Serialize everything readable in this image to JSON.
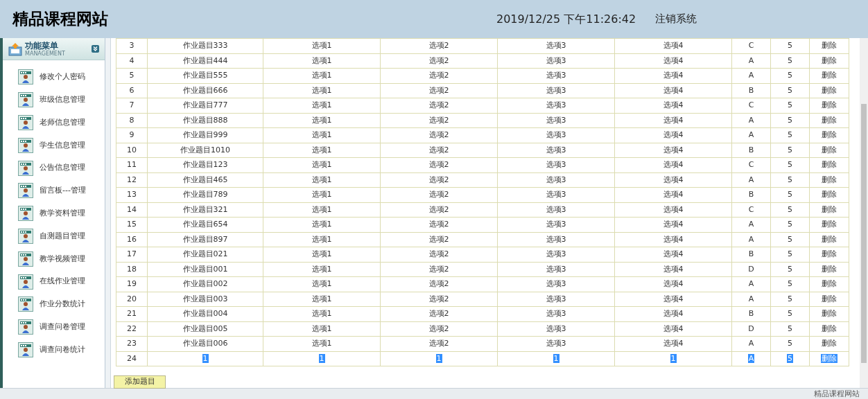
{
  "header": {
    "title": "精品课程网站",
    "datetime": "2019/12/25 下午11:26:42",
    "logout": "注销系统"
  },
  "sidebar": {
    "title": "功能菜单",
    "subtitle": "MANAGEMENT",
    "items": [
      {
        "label": "修改个人密码"
      },
      {
        "label": "班级信息管理"
      },
      {
        "label": "老师信息管理"
      },
      {
        "label": "学生信息管理"
      },
      {
        "label": "公告信息管理"
      },
      {
        "label": "留言板---管理"
      },
      {
        "label": "教学资料管理"
      },
      {
        "label": "自测题目管理"
      },
      {
        "label": "教学视频管理"
      },
      {
        "label": "在线作业管理"
      },
      {
        "label": "作业分数统计"
      },
      {
        "label": "调查问卷管理"
      },
      {
        "label": "调查问卷统计"
      }
    ]
  },
  "table": {
    "rows": [
      {
        "no": "3",
        "title": "作业题目333",
        "options": [
          "选项1",
          "选项2",
          "选项3",
          "选项4"
        ],
        "answer": "C",
        "score": "5",
        "action": "删除",
        "text_selected": false
      },
      {
        "no": "4",
        "title": "作业题目444",
        "options": [
          "选项1",
          "选项2",
          "选项3",
          "选项4"
        ],
        "answer": "A",
        "score": "5",
        "action": "删除",
        "text_selected": false
      },
      {
        "no": "5",
        "title": "作业题目555",
        "options": [
          "选项1",
          "选项2",
          "选项3",
          "选项4"
        ],
        "answer": "A",
        "score": "5",
        "action": "删除",
        "text_selected": false
      },
      {
        "no": "6",
        "title": "作业题目666",
        "options": [
          "选项1",
          "选项2",
          "选项3",
          "选项4"
        ],
        "answer": "B",
        "score": "5",
        "action": "删除",
        "text_selected": false
      },
      {
        "no": "7",
        "title": "作业题目777",
        "options": [
          "选项1",
          "选项2",
          "选项3",
          "选项4"
        ],
        "answer": "C",
        "score": "5",
        "action": "删除",
        "text_selected": false
      },
      {
        "no": "8",
        "title": "作业题目888",
        "options": [
          "选项1",
          "选项2",
          "选项3",
          "选项4"
        ],
        "answer": "A",
        "score": "5",
        "action": "删除",
        "text_selected": false
      },
      {
        "no": "9",
        "title": "作业题目999",
        "options": [
          "选项1",
          "选项2",
          "选项3",
          "选项4"
        ],
        "answer": "A",
        "score": "5",
        "action": "删除",
        "text_selected": false
      },
      {
        "no": "10",
        "title": "作业题目1010",
        "options": [
          "选项1",
          "选项2",
          "选项3",
          "选项4"
        ],
        "answer": "B",
        "score": "5",
        "action": "删除",
        "text_selected": false
      },
      {
        "no": "11",
        "title": "作业题目123",
        "options": [
          "选项1",
          "选项2",
          "选项3",
          "选项4"
        ],
        "answer": "C",
        "score": "5",
        "action": "删除",
        "text_selected": false
      },
      {
        "no": "12",
        "title": "作业题目465",
        "options": [
          "选项1",
          "选项2",
          "选项3",
          "选项4"
        ],
        "answer": "A",
        "score": "5",
        "action": "删除",
        "text_selected": false
      },
      {
        "no": "13",
        "title": "作业题目789",
        "options": [
          "选项1",
          "选项2",
          "选项3",
          "选项4"
        ],
        "answer": "B",
        "score": "5",
        "action": "删除",
        "text_selected": false
      },
      {
        "no": "14",
        "title": "作业题目321",
        "options": [
          "选项1",
          "选项2",
          "选项3",
          "选项4"
        ],
        "answer": "C",
        "score": "5",
        "action": "删除",
        "text_selected": false
      },
      {
        "no": "15",
        "title": "作业题目654",
        "options": [
          "选项1",
          "选项2",
          "选项3",
          "选项4"
        ],
        "answer": "A",
        "score": "5",
        "action": "删除",
        "text_selected": false
      },
      {
        "no": "16",
        "title": "作业题目897",
        "options": [
          "选项1",
          "选项2",
          "选项3",
          "选项4"
        ],
        "answer": "A",
        "score": "5",
        "action": "删除",
        "text_selected": false
      },
      {
        "no": "17",
        "title": "作业题目021",
        "options": [
          "选项1",
          "选项2",
          "选项3",
          "选项4"
        ],
        "answer": "B",
        "score": "5",
        "action": "删除",
        "text_selected": false
      },
      {
        "no": "18",
        "title": "作业题目001",
        "options": [
          "选项1",
          "选项2",
          "选项3",
          "选项4"
        ],
        "answer": "D",
        "score": "5",
        "action": "删除",
        "text_selected": false
      },
      {
        "no": "19",
        "title": "作业题目002",
        "options": [
          "选项1",
          "选项2",
          "选项3",
          "选项4"
        ],
        "answer": "A",
        "score": "5",
        "action": "删除",
        "text_selected": false
      },
      {
        "no": "20",
        "title": "作业题目003",
        "options": [
          "选项1",
          "选项2",
          "选项3",
          "选项4"
        ],
        "answer": "A",
        "score": "5",
        "action": "删除",
        "text_selected": false
      },
      {
        "no": "21",
        "title": "作业题目004",
        "options": [
          "选项1",
          "选项2",
          "选项3",
          "选项4"
        ],
        "answer": "B",
        "score": "5",
        "action": "删除",
        "text_selected": false
      },
      {
        "no": "22",
        "title": "作业题目005",
        "options": [
          "选项1",
          "选项2",
          "选项3",
          "选项4"
        ],
        "answer": "D",
        "score": "5",
        "action": "删除",
        "text_selected": false
      },
      {
        "no": "23",
        "title": "作业题目006",
        "options": [
          "选项1",
          "选项2",
          "选项3",
          "选项4"
        ],
        "answer": "A",
        "score": "5",
        "action": "删除",
        "text_selected": false
      },
      {
        "no": "24",
        "title": "1",
        "options": [
          "1",
          "1",
          "1",
          "1"
        ],
        "answer": "A",
        "score": "5",
        "action": "删除",
        "text_selected": true
      }
    ]
  },
  "add_button": "添加题目",
  "status_bar": {
    "right_text": "精品课程网站"
  }
}
